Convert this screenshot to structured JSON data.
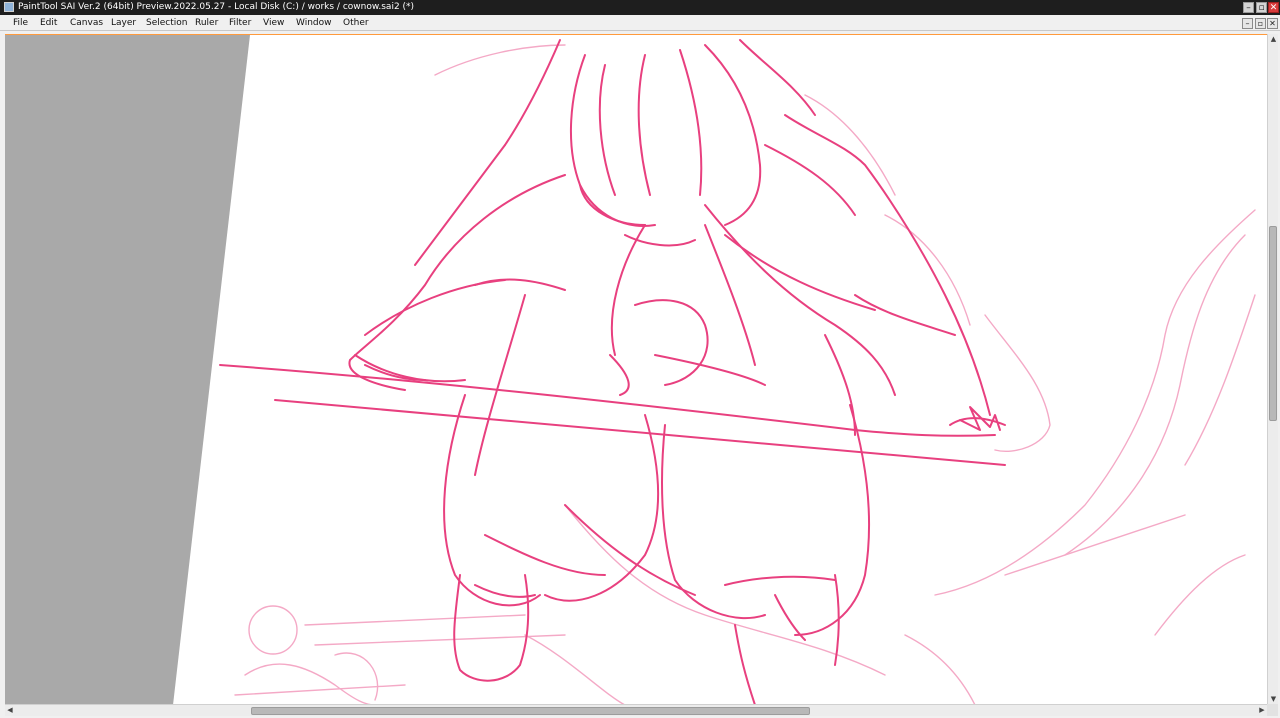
{
  "window": {
    "title": "PaintTool SAI Ver.2 (64bit) Preview.2022.05.27 - Local Disk (C:) / works / cownow.sai2 (*)",
    "minimize_glyph": "–",
    "maximize_glyph": "▫",
    "close_glyph": "✕"
  },
  "menu": {
    "items": [
      "File",
      "Edit",
      "Canvas",
      "Layer",
      "Selection",
      "Ruler",
      "Filter",
      "View",
      "Window",
      "Other"
    ]
  },
  "mdi": {
    "minimize_glyph": "–",
    "restore_glyph": "▫",
    "close_glyph": "✕"
  },
  "scrollbars": {
    "up_glyph": "▲",
    "down_glyph": "▼",
    "left_glyph": "◀",
    "right_glyph": "▶",
    "vertical_thumb_start_fraction": 0.28,
    "vertical_thumb_length_fraction": 0.3,
    "horizontal_thumb_start_fraction": 0.19,
    "horizontal_thumb_length_fraction": 0.45
  },
  "colors": {
    "sketch_stroke": "#e8407f",
    "sketch_faint": "#f4a9c6",
    "canvas_bg": "#ffffff",
    "backdrop_gray": "#a9a9a9",
    "title_bar": "#1e1e1e",
    "accent_border": "#ff9a3c"
  },
  "icons": {
    "app": "painttool-sai-icon"
  }
}
